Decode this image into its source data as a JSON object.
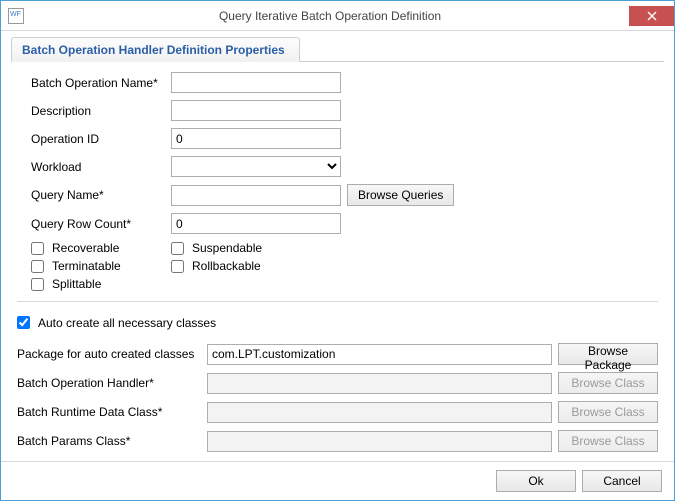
{
  "window": {
    "title": "Query Iterative Batch Operation Definition"
  },
  "section": {
    "title": "Batch Operation Handler Definition Properties"
  },
  "labels": {
    "batch_name": "Batch Operation Name*",
    "description": "Description",
    "operation_id": "Operation ID",
    "workload": "Workload",
    "query_name": "Query Name*",
    "query_row_count": "Query Row Count*",
    "recoverable": "Recoverable",
    "suspendable": "Suspendable",
    "terminatable": "Terminatable",
    "rollbackable": "Rollbackable",
    "splittable": "Splittable",
    "auto_create": "Auto create all necessary classes",
    "pkg_label": "Package for auto created classes",
    "handler": "Batch Operation Handler*",
    "runtime": "Batch Runtime Data Class*",
    "params": "Batch Params Class*"
  },
  "values": {
    "batch_name": "",
    "description": "",
    "operation_id": "0",
    "workload": "",
    "query_name": "",
    "query_row_count": "0",
    "recoverable": false,
    "suspendable": false,
    "terminatable": false,
    "rollbackable": false,
    "splittable": false,
    "auto_create": true,
    "pkg": "com.LPT.customization",
    "handler": "",
    "runtime": "",
    "params": ""
  },
  "buttons": {
    "browse_queries": "Browse Queries",
    "browse_package": "Browse Package",
    "browse_class": "Browse Class",
    "ok": "Ok",
    "cancel": "Cancel"
  }
}
